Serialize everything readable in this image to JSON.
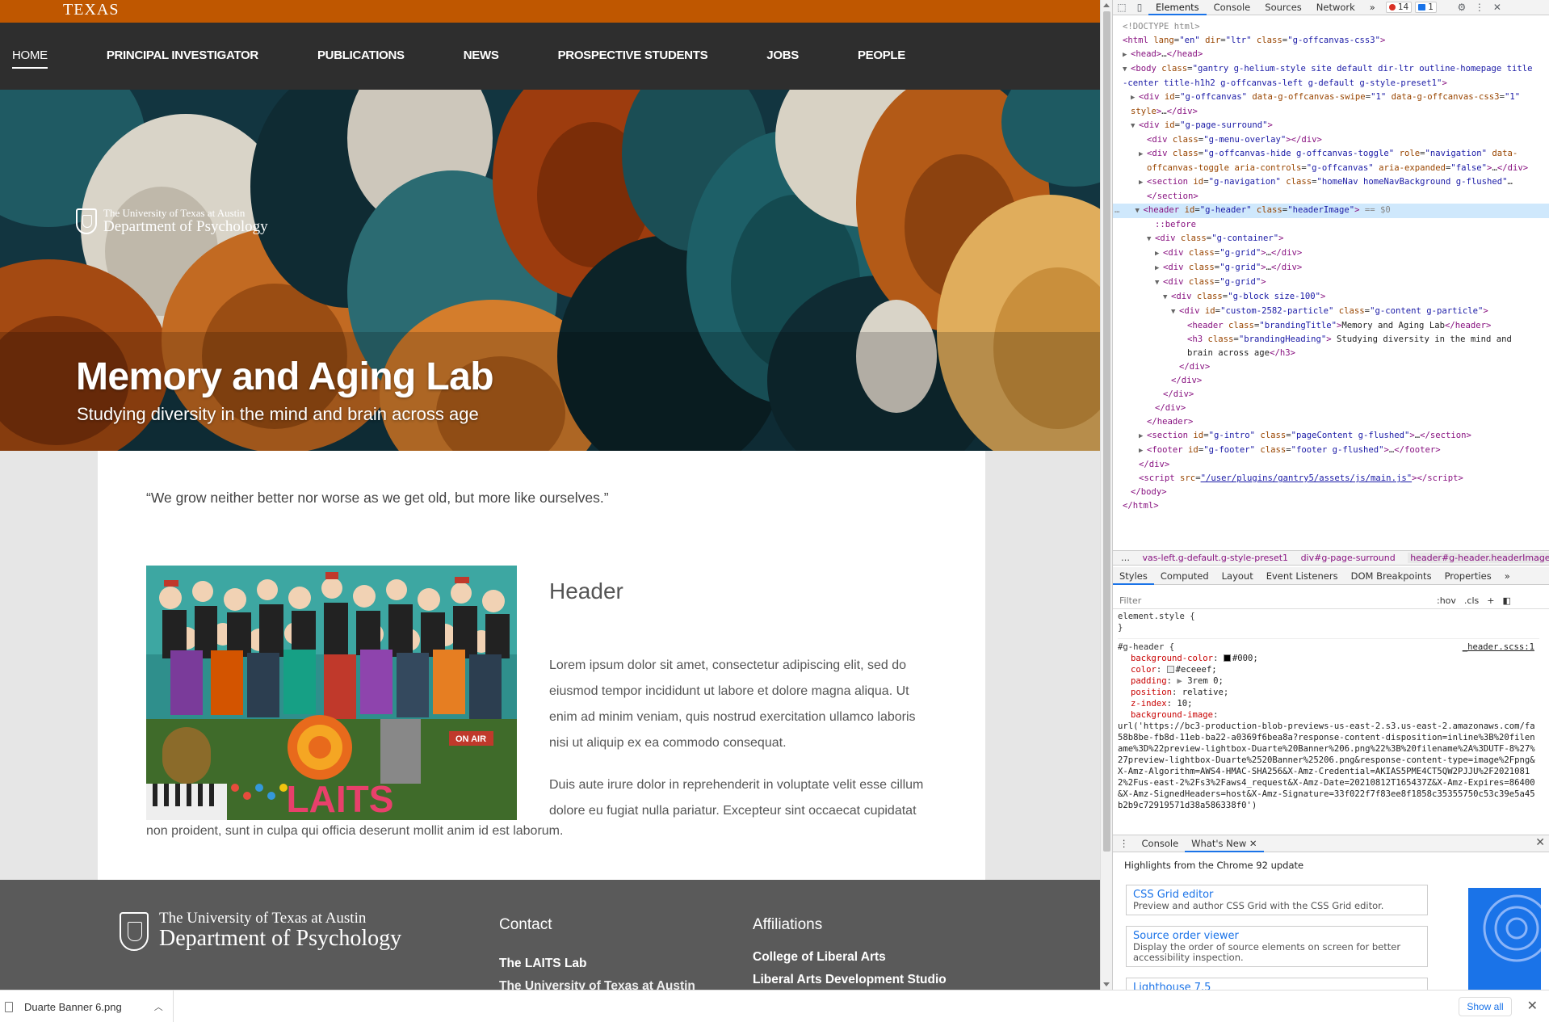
{
  "page": {
    "topbar_logo": "TEXAS",
    "nav": [
      "HOME",
      "PRINCIPAL INVESTIGATOR",
      "PUBLICATIONS",
      "NEWS",
      "PROSPECTIVE STUDENTS",
      "JOBS",
      "PEOPLE"
    ],
    "brand_line1": "The University of Texas at Austin",
    "brand_line2": "Department of Psychology",
    "hero_title": "Memory and Aging Lab",
    "hero_subtitle": "Studying diversity in the mind and brain across age",
    "quote": "“We grow neither better nor worse as we get old, but more like ourselves.”",
    "section_heading": "Header",
    "para1": "Lorem ipsum dolor sit amet, consectetur adipiscing elit, sed do eiusmod tempor incididunt ut labore et dolore magna aliqua. Ut enim ad minim veniam, quis nostrud exercitation ullamco laboris nisi ut aliquip ex ea commodo consequat.",
    "para2": "Duis aute irure dolor in reprehenderit in voluptate velit esse cillum dolore eu fugiat nulla pariatur. Excepteur sint occaecat cupidatat",
    "para2b": "non proident, sunt in culpa qui officia deserunt mollit anim id est laborum.",
    "collage_text": "LAITS",
    "collage_sign": "ON AIR",
    "footer": {
      "brand_line1": "The University of Texas at Austin",
      "brand_line2": "Department of Psychology",
      "contact_heading": "Contact",
      "contact_item": "The LAITS Lab",
      "contact_item2": "The University of Texas at Austin",
      "affil_heading": "Affiliations",
      "affil_item1": "College of Liberal Arts",
      "affil_item2": "Liberal Arts Development Studio"
    }
  },
  "devtools": {
    "tabs": [
      "Elements",
      "Console",
      "Sources",
      "Network"
    ],
    "more": "»",
    "error_count": "14",
    "message_count": "1",
    "breadcrumb": [
      "vas-left.g-default.g-style-preset1",
      "div#g-page-surround",
      "header#g-header.headerImage"
    ],
    "breadcrumb_more": "…",
    "sub_tabs": [
      "Styles",
      "Computed",
      "Layout",
      "Event Listeners",
      "DOM Breakpoints",
      "Properties"
    ],
    "filter_placeholder": "Filter",
    "hov": ":hov",
    "cls": ".cls",
    "element_style": "element.style {",
    "element_style_close": "}",
    "rule_selector": "#g-header {",
    "rule_source": "_header.scss:1",
    "props": [
      {
        "name": "background-color",
        "value": "#000;"
      },
      {
        "name": "color",
        "value": "#eceeef;"
      },
      {
        "name": "padding",
        "value": "3rem 0;"
      },
      {
        "name": "position",
        "value": "relative;"
      },
      {
        "name": "z-index",
        "value": "10;"
      },
      {
        "name": "background-image",
        "value": ""
      }
    ],
    "bg_url": "url('https://bc3-production-blob-previews-us-east-2.s3.us-east-2.amazonaws.com/fa58b8be-fb8d-11eb-ba22-a0369f6bea8a?response-content-disposition=inline%3B%20filename%3D%22preview-lightbox-Duarte%20Banner%206.png%22%3B%20filename%2A%3DUTF-8%27%27preview-lightbox-Duarte%2520Banner%25206.png&response-content-type=image%2Fpng&X-Amz-Algorithm=AWS4-HMAC-SHA256&X-Amz-Credential=AKIAS5PME4CT5QW2PJJU%2F20210812%2Fus-east-2%2Fs3%2Faws4_request&X-Amz-Date=20210812T165437Z&X-Amz-Expires=86400&X-Amz-SignedHeaders=host&X-Amz-Signature=33f022f7f83ee8f1858c35355750c53c39e5a45b2b9c72919571d38a586338f0')",
    "drawer_tabs": [
      "Console",
      "What's New"
    ],
    "whatsnew_title": "Highlights from the Chrome 92 update",
    "cards": [
      {
        "title": "CSS Grid editor",
        "desc": "Preview and author CSS Grid with the CSS Grid editor."
      },
      {
        "title": "Source order viewer",
        "desc": "Display the order of source elements on screen for better accessibility inspection."
      },
      {
        "title": "Lighthouse 7.5",
        "desc": ""
      }
    ]
  },
  "download_bar": {
    "file": "Duarte Banner 6.png",
    "show_all": "Show all"
  },
  "colors": {
    "burnt_orange": "#bf5700",
    "nav_bg": "#2e2e2e",
    "footer_bg": "#5a5a5a",
    "devtools_accent": "#1a73e8"
  }
}
